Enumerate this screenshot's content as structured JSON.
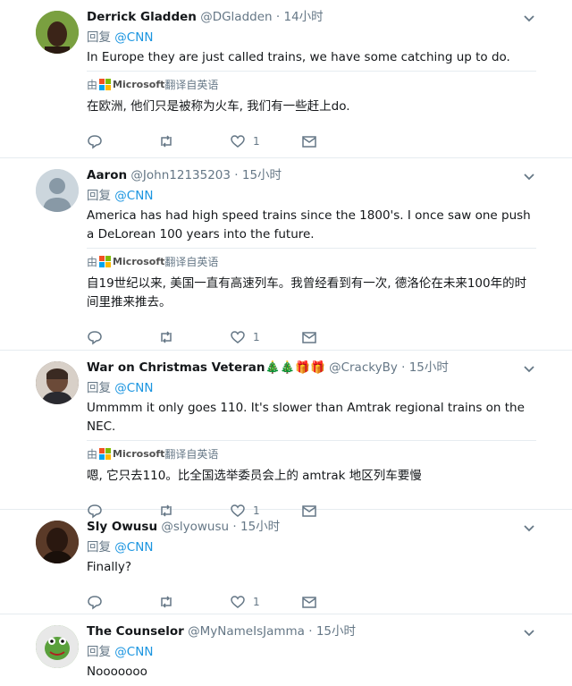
{
  "common": {
    "reply_prefix": "回复",
    "reply_to": "@CNN",
    "translated_by": "由",
    "translator_brand": "Microsoft",
    "translated_from": "翻译自英语"
  },
  "tweets": [
    {
      "name": "Derrick Gladden",
      "handle": "@DGladden",
      "time": "14小时",
      "text": "In Europe they are just called trains, we have some catching up to do.",
      "translation": "在欧洲, 他们只是被称为火车, 我们有一些赶上do.",
      "likes": "1",
      "avatar_color": "#6b8f3a"
    },
    {
      "name": "Aaron",
      "handle": "@John12135203",
      "time": "15小时",
      "text": "America has had high speed trains since the 1800's. I once saw one push a DeLorean 100 years into the future.",
      "translation": "自19世纪以来, 美国一直有高速列车。我曾经看到有一次, 德洛伦在未来100年的时间里推来推去。",
      "likes": "1",
      "avatar_color": "#ccd6dd"
    },
    {
      "name": "War on Christmas Veteran",
      "emoji": "🎄🎄🎁🎁",
      "handle": "@CrackyBy",
      "time": "15小时",
      "text": "Ummmm it only goes 110. It's slower than Amtrak regional trains on the NEC.",
      "translation": "嗯, 它只去110。比全国选举委员会上的 amtrak 地区列车要慢",
      "likes": "1",
      "avatar_color": "#5a4a3a"
    },
    {
      "name": "Sly Owusu",
      "handle": "@slyowusu",
      "time": "15小时",
      "text": "Finally?",
      "likes": "1",
      "avatar_color": "#3a2a20"
    },
    {
      "name": "The Counselor",
      "handle": "@MyNameIsJamma",
      "time": "15小时",
      "text": "Nooooooo",
      "avatar_color": "#5aa03c"
    }
  ],
  "colors": {
    "accent": "#1b95e0",
    "muted": "#657786",
    "border": "#e6ecf0"
  }
}
